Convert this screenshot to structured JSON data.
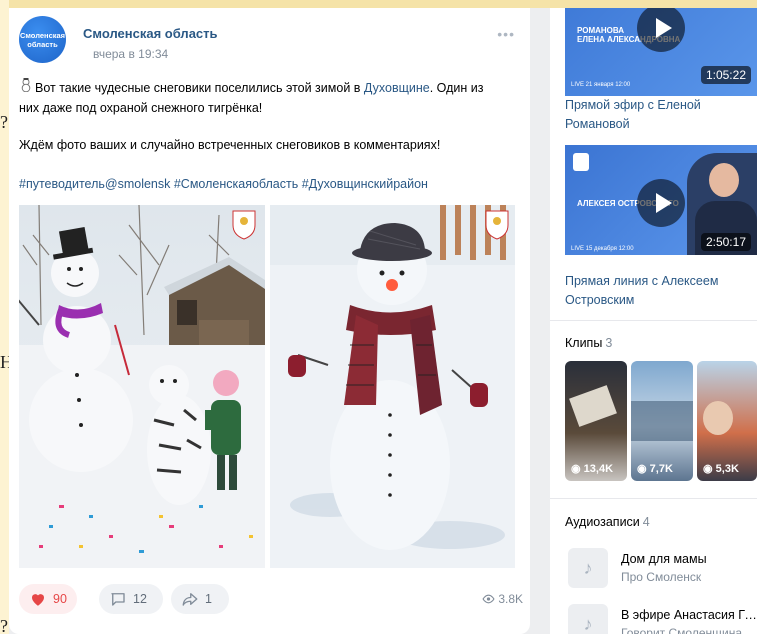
{
  "post": {
    "author": "Смоленская область",
    "avatar_text": "Смоленская область",
    "time": "вчера в 19:34",
    "text_before_link": "Вот такие чудесные снеговики поселились этой зимой в ",
    "text_link": "Духовщине",
    "text_after_link": ". Один из",
    "text_line2": "них даже под охраной снежного тигрёнка!",
    "text_p2": "Ждём фото ваших и случайно встреченных снеговиков в комментариях!",
    "hashtags": "#путеводитель@smolensk #Смоленскаяобласть #Духовщинскийрайон",
    "likes": "90",
    "comments": "12",
    "shares": "1",
    "views": "3.8K",
    "more": "•••"
  },
  "sidebar": {
    "videos": [
      {
        "title": "Прямой эфир с Еленой Романовой",
        "duration": "1:05:22",
        "thumb_line1": "РОМАНОВА",
        "thumb_line2": "ЕЛЕНА АЛЕКСАНДРОВНА",
        "live_label": "LIVE  21 января 12:00"
      },
      {
        "title": "Прямая линия с Алексеем Островским",
        "duration": "2:50:17",
        "thumb_line1": "АЛЕКСЕЯ ОСТРОВСКОГО",
        "live_label": "LIVE  15 декабря 12:00"
      }
    ],
    "clips_title": "Клипы",
    "clips_count": "3",
    "clips": [
      {
        "views": "13,4K"
      },
      {
        "views": "7,7K"
      },
      {
        "views": "5,3K"
      }
    ],
    "audio_title": "Аудиозаписи",
    "audio_count": "4",
    "audio": [
      {
        "title": "Дом для мамы",
        "artist": "Про Смоленск"
      },
      {
        "title": "В эфире Анастасия Гре...",
        "artist": "Говорит Смоленщина"
      }
    ]
  },
  "edge": {
    "glyph1": "?",
    "glyph2": "Н",
    "glyph3": "?"
  }
}
